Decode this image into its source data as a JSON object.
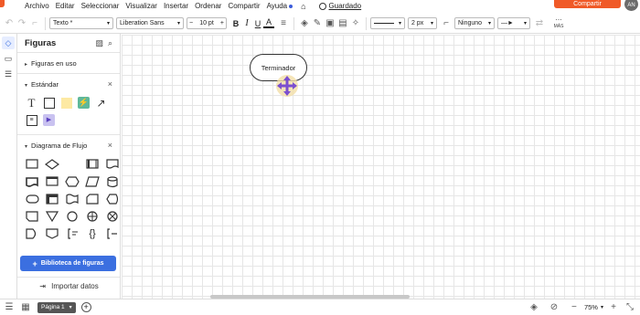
{
  "menubar": {
    "items": [
      "Archivo",
      "Editar",
      "Seleccionar",
      "Visualizar",
      "Insertar",
      "Ordenar",
      "Compartir",
      "Ayuda"
    ],
    "saved_label": "Guardado",
    "share_label": "Compartir",
    "avatar_initials": "AN"
  },
  "toolbar": {
    "style_select": "Texto *",
    "font_select": "Liberation Sans",
    "font_size": "10 pt",
    "line_width": "2 px",
    "line_end": "Ninguno",
    "more_label": "MÁS"
  },
  "panel": {
    "title": "Figuras",
    "sections": {
      "in_use": "Figuras en uso",
      "standard": "Estándar",
      "flowchart": "Diagrama de Flujo"
    },
    "library_button": "Biblioteca de figuras",
    "import_label": "Importar datos"
  },
  "canvas": {
    "terminator_label": "Terminador"
  },
  "statusbar": {
    "page_label": "Página 1",
    "zoom": "75%"
  },
  "colors": {
    "accent": "#3b6fe0",
    "brand": "#f05a28",
    "move_handle": "#7b4fcf"
  }
}
